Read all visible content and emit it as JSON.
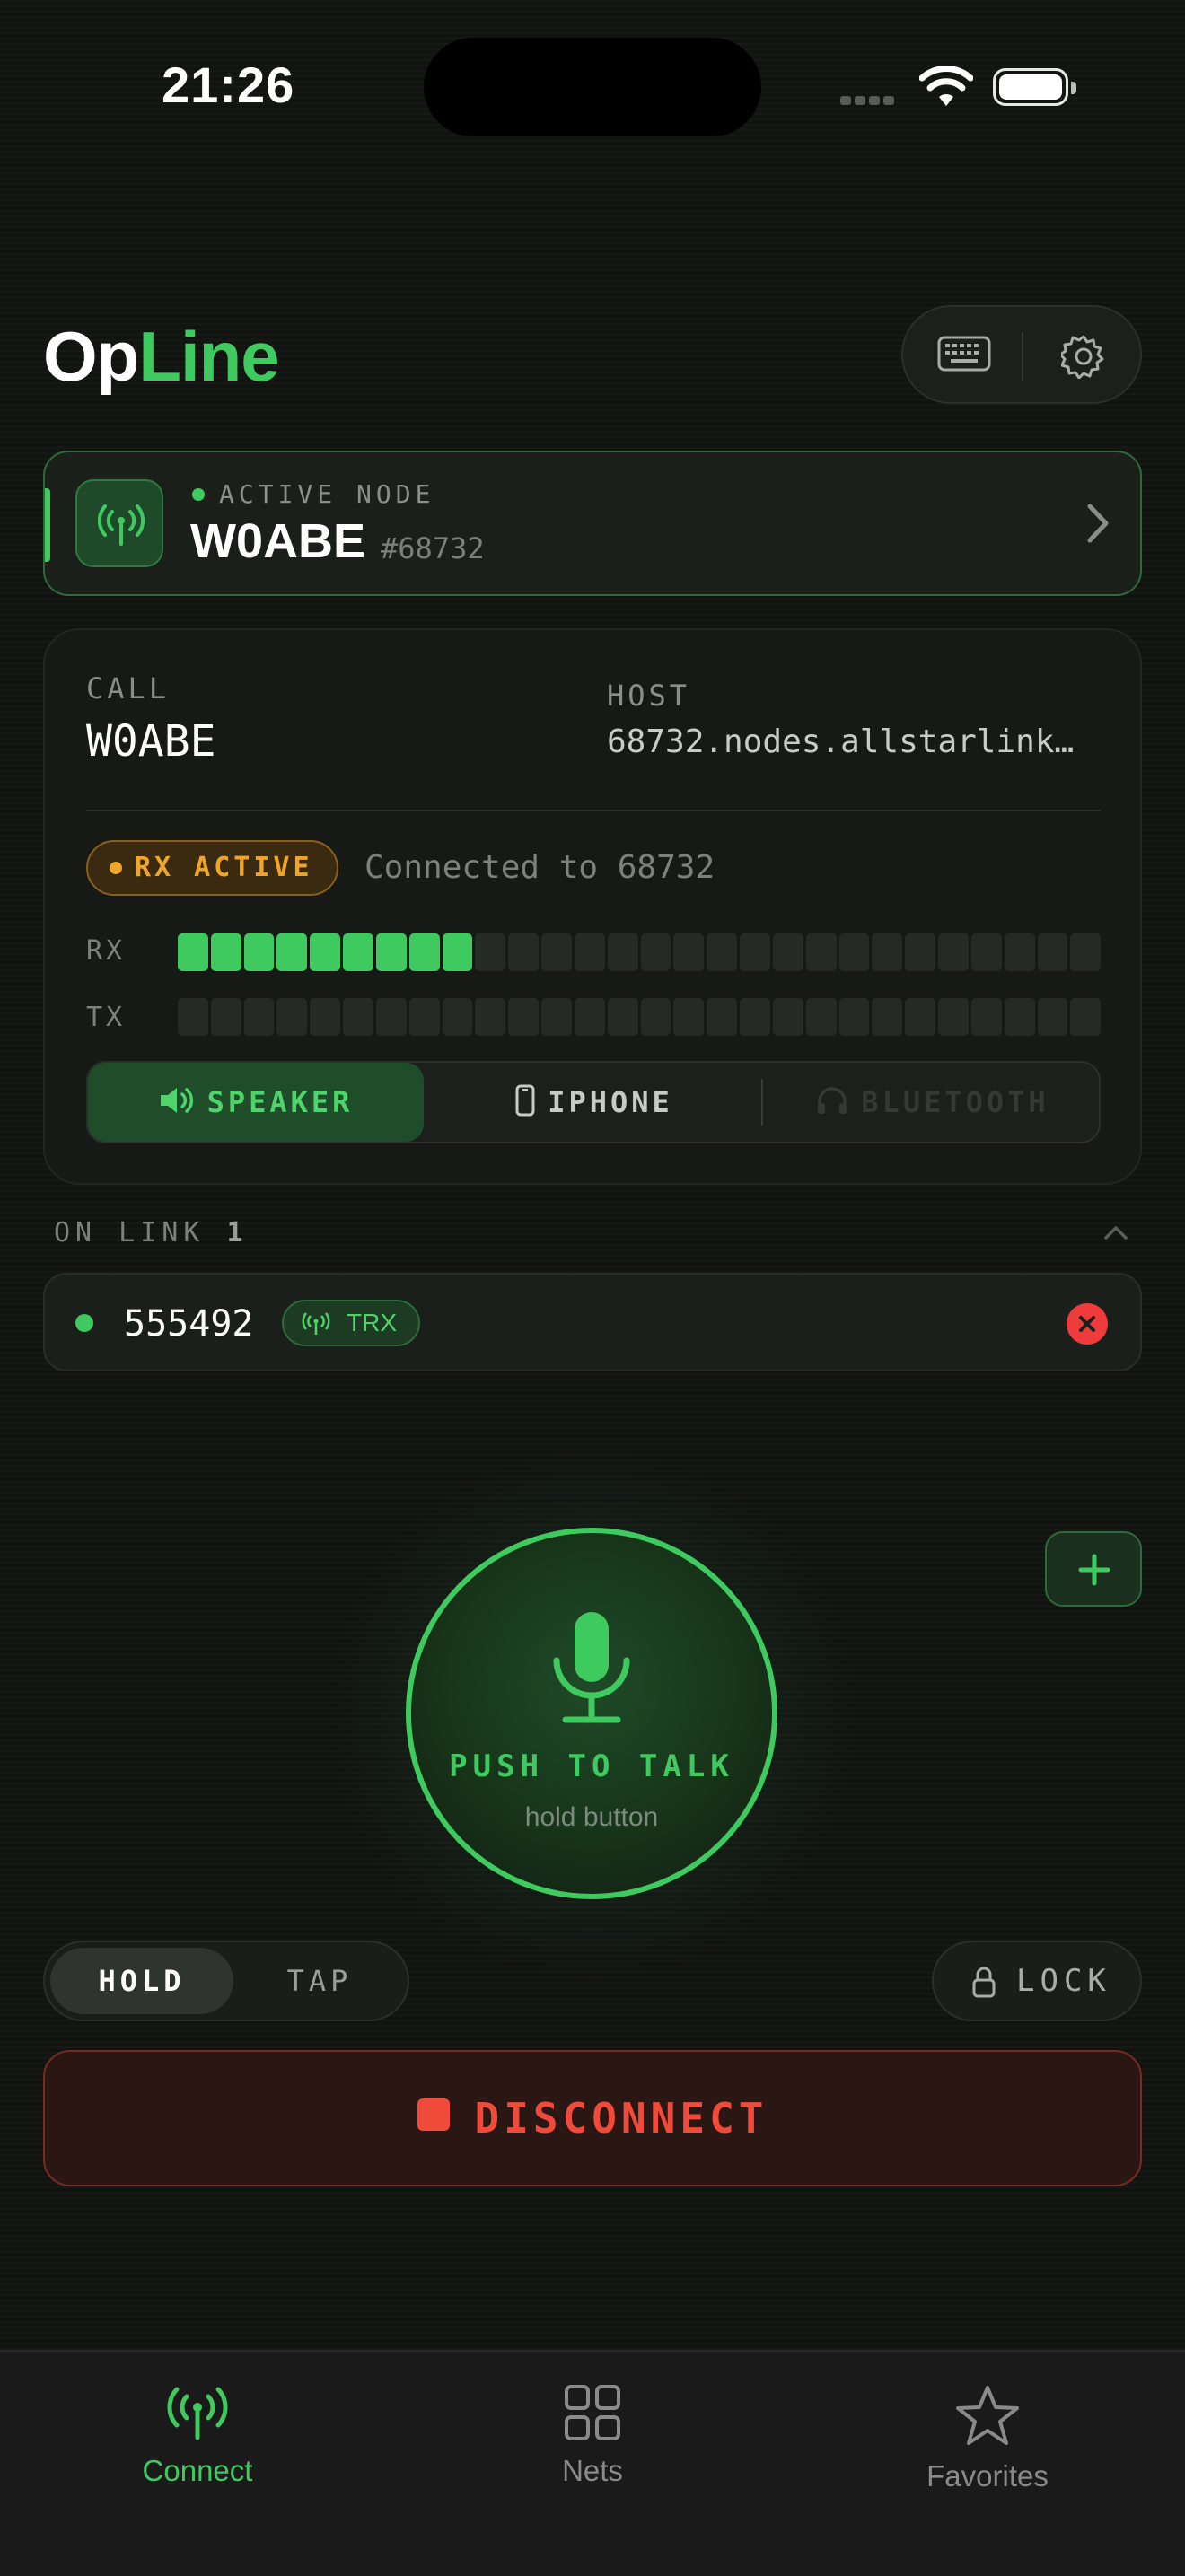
{
  "status_bar": {
    "time": "21:26"
  },
  "header": {
    "logo_part1": "Op",
    "logo_part2": "Line"
  },
  "active_node": {
    "label": "ACTIVE NODE",
    "callsign": "W0ABE",
    "node_number": "#68732"
  },
  "panel": {
    "call_label": "CALL",
    "call_value": "W0ABE",
    "host_label": "HOST",
    "host_value": "68732.nodes.allstarlink…",
    "rx_badge": "RX ACTIVE",
    "connection_text": "Connected to 68732",
    "rx_label": "RX",
    "tx_label": "TX",
    "rx_level": 9,
    "tx_level": 0,
    "meter_segments": 28,
    "audio_outputs": [
      {
        "label": "SPEAKER",
        "selected": true,
        "enabled": true
      },
      {
        "label": "IPHONE",
        "selected": false,
        "enabled": true
      },
      {
        "label": "BLUETOOTH",
        "selected": false,
        "enabled": false
      }
    ]
  },
  "links": {
    "header_label": "ON LINK",
    "count": "1",
    "items": [
      {
        "node_id": "555492",
        "mode": "TRX"
      }
    ]
  },
  "ptt": {
    "title": "PUSH TO TALK",
    "subtitle": "hold button"
  },
  "mode_toggle": {
    "hold": "HOLD",
    "tap": "TAP",
    "selected": "HOLD"
  },
  "lock_label": "LOCK",
  "disconnect_label": "DISCONNECT",
  "tabs": [
    {
      "label": "Connect",
      "icon": "antenna-icon",
      "active": true
    },
    {
      "label": "Nets",
      "icon": "grid-icon",
      "active": false
    },
    {
      "label": "Favorites",
      "icon": "star-icon",
      "active": false
    }
  ],
  "colors": {
    "accent_green": "#3fca5f",
    "rx_orange": "#f0a52a",
    "danger_red": "#ef4a3a",
    "background": "#111411"
  }
}
